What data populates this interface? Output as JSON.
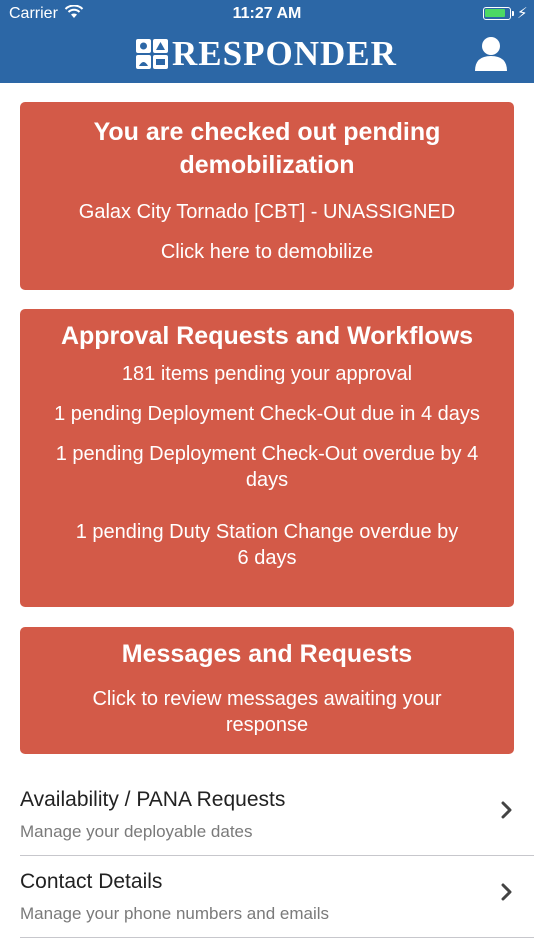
{
  "status_bar": {
    "carrier": "Carrier",
    "time": "11:27 AM"
  },
  "header": {
    "app_title": "RESPONDER",
    "profile_icon": "user-icon"
  },
  "checkout_card": {
    "title": "You are checked out pending demobilization",
    "incident": "Galax City Tornado [CBT] - UNASSIGNED",
    "action": "Click here to demobilize"
  },
  "approvals_card": {
    "title": "Approval Requests and Workflows",
    "items": [
      "181 items pending your approval",
      "1 pending Deployment Check-Out due in 4 days",
      "1 pending Deployment Check-Out overdue by 4 days",
      "1 pending Duty Station Change overdue by 6 days"
    ]
  },
  "messages_card": {
    "title": "Messages and Requests",
    "action": "Click to review messages awaiting your response"
  },
  "menu": [
    {
      "title": "Availability / PANA Requests",
      "subtitle": "Manage your deployable dates"
    },
    {
      "title": "Contact Details",
      "subtitle": "Manage your phone numbers and emails"
    }
  ],
  "colors": {
    "header_bg": "#2c67a6",
    "card_bg": "#d35a48",
    "battery_fill": "#4cd964"
  },
  "battery_level": 0.9
}
